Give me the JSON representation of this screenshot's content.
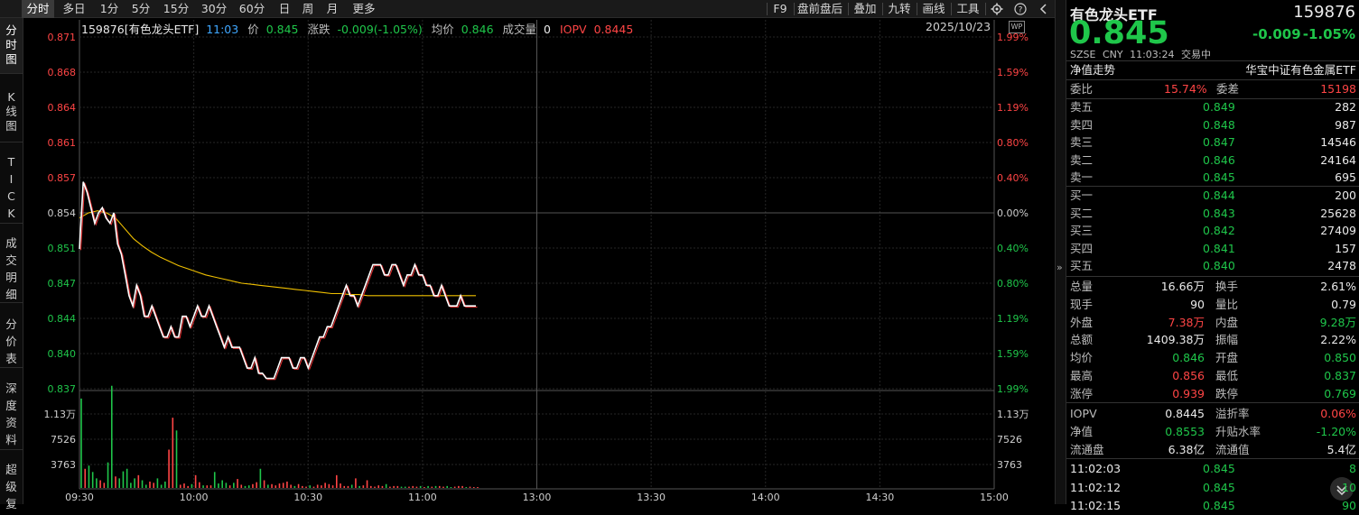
{
  "toolbar": {
    "tabs": [
      "分时",
      "多日",
      "1分",
      "5分",
      "15分",
      "30分",
      "60分",
      "日",
      "周",
      "月",
      "更多"
    ],
    "right_tools": [
      "F9",
      "盘前盘后",
      "叠加",
      "九转",
      "画线",
      "工具"
    ],
    "icons": [
      "settings-icon",
      "help-icon",
      "collapse-left-icon"
    ]
  },
  "sidetabs": [
    {
      "label": "分\n时\n图"
    },
    {
      "label": "K\n线\n图"
    },
    {
      "label": "T\nI\nC\nK"
    },
    {
      "label": "成\n交\n明\n细"
    },
    {
      "label": "分\n价\n表"
    },
    {
      "label": "深\n度\n资\n料"
    },
    {
      "label": "超\n级\n复"
    }
  ],
  "info": {
    "code_name": "159876[有色龙头ETF]",
    "time": "11:03",
    "price_label": "价",
    "price": "0.845",
    "change_label": "涨跌",
    "change": "-0.009(-1.05%)",
    "avg_label": "均价",
    "avg": "0.846",
    "volume_label": "成交量",
    "volume": "0",
    "iopv_label": "IOPV",
    "iopv": "0.8445",
    "date": "2025/10/23",
    "wp_badge": "WP"
  },
  "chart_data": {
    "type": "line",
    "price_ticks": [
      "0.871",
      "0.868",
      "0.864",
      "0.861",
      "0.857",
      "0.854",
      "0.851",
      "0.847",
      "0.844",
      "0.840",
      "0.837"
    ],
    "pct_ticks": [
      "1.99%",
      "1.59%",
      "1.19%",
      "0.80%",
      "0.40%",
      "0.00%",
      "0.40%",
      "0.80%",
      "1.19%",
      "1.59%",
      "1.99%"
    ],
    "ylim": [
      0.837,
      0.871
    ],
    "prev_close": 0.854,
    "x_ticks": [
      "09:30",
      "10:00",
      "10:30",
      "11:00",
      "13:00",
      "13:30",
      "14:00",
      "14:30",
      "15:00"
    ],
    "volume_ticks": [
      "1.13万",
      "7526",
      "3763"
    ],
    "volume_max": 15000,
    "price_series": [
      0.8505,
      0.857,
      0.856,
      0.8545,
      0.853,
      0.854,
      0.8545,
      0.8535,
      0.853,
      0.854,
      0.851,
      0.85,
      0.848,
      0.846,
      0.845,
      0.847,
      0.846,
      0.844,
      0.844,
      0.845,
      0.844,
      0.843,
      0.842,
      0.842,
      0.843,
      0.842,
      0.842,
      0.844,
      0.844,
      0.843,
      0.844,
      0.845,
      0.844,
      0.844,
      0.845,
      0.844,
      0.843,
      0.842,
      0.841,
      0.842,
      0.841,
      0.841,
      0.841,
      0.84,
      0.839,
      0.839,
      0.84,
      0.8385,
      0.8385,
      0.838,
      0.838,
      0.838,
      0.839,
      0.84,
      0.84,
      0.84,
      0.839,
      0.839,
      0.84,
      0.84,
      0.839,
      0.84,
      0.841,
      0.842,
      0.842,
      0.843,
      0.843,
      0.844,
      0.845,
      0.846,
      0.847,
      0.846,
      0.846,
      0.845,
      0.846,
      0.847,
      0.848,
      0.849,
      0.849,
      0.849,
      0.848,
      0.848,
      0.849,
      0.849,
      0.848,
      0.847,
      0.848,
      0.848,
      0.849,
      0.848,
      0.848,
      0.847,
      0.847,
      0.846,
      0.846,
      0.847,
      0.846,
      0.845,
      0.845,
      0.845,
      0.846,
      0.845,
      0.845,
      0.845,
      0.845
    ],
    "avg_series": [
      0.8535,
      0.854,
      0.8542,
      0.854,
      0.8535,
      0.8525,
      0.8515,
      0.8508,
      0.8502,
      0.8497,
      0.8493,
      0.8489,
      0.8486,
      0.8483,
      0.848,
      0.8478,
      0.8476,
      0.8474,
      0.8472,
      0.8471,
      0.847,
      0.8469,
      0.8468,
      0.8467,
      0.8466,
      0.8465,
      0.8464,
      0.8463,
      0.8462,
      0.8462,
      0.8461,
      0.8461,
      0.846,
      0.846,
      0.846,
      0.846,
      0.846,
      0.846,
      0.846,
      0.846,
      0.846,
      0.846,
      0.846,
      0.846,
      0.846
    ],
    "volume_series": [
      14000,
      3000,
      3500,
      2500,
      1500,
      1200,
      800,
      4000,
      16000,
      1800,
      1500,
      2600,
      3000,
      800,
      1500,
      2000,
      1200,
      500,
      1000,
      800,
      1500,
      500,
      1000,
      6000,
      11000,
      9000,
      500,
      700,
      300,
      600,
      2000,
      900,
      400,
      400,
      400,
      2500,
      700,
      1200,
      800,
      400,
      800,
      1400,
      500,
      300,
      400,
      600,
      900,
      3000,
      1200,
      500,
      600,
      400,
      700,
      800,
      1000,
      500,
      300,
      600,
      300,
      200,
      400,
      200,
      500,
      400,
      800,
      600,
      400,
      2000,
      700,
      300,
      300,
      500,
      1500,
      300,
      400,
      1200,
      300,
      200,
      400,
      300,
      600,
      200,
      300,
      300,
      200,
      200,
      200,
      300,
      200,
      300,
      100,
      300,
      200,
      300,
      300,
      200,
      300,
      100,
      200,
      300,
      300,
      100,
      200,
      100,
      100
    ]
  },
  "panel": {
    "name": "有色龙头ETF",
    "code": "159876",
    "price": "0.845",
    "change": "-0.009",
    "change_pct": "-1.05%",
    "exchange": "SZSE",
    "currency": "CNY",
    "time": "11:03:24",
    "status": "交易中",
    "nav_trend": "净值走势",
    "index_name": "华宝中证有色金属ETF",
    "weibi_label": "委比",
    "weibi": "15.74%",
    "weicha_label": "委差",
    "weicha": "15198",
    "asks": [
      {
        "label": "卖五",
        "price": "0.849",
        "vol": "282"
      },
      {
        "label": "卖四",
        "price": "0.848",
        "vol": "987"
      },
      {
        "label": "卖三",
        "price": "0.847",
        "vol": "14546"
      },
      {
        "label": "卖二",
        "price": "0.846",
        "vol": "24164"
      },
      {
        "label": "卖一",
        "price": "0.845",
        "vol": "695"
      }
    ],
    "bids": [
      {
        "label": "买一",
        "price": "0.844",
        "vol": "200"
      },
      {
        "label": "买二",
        "price": "0.843",
        "vol": "25628"
      },
      {
        "label": "买三",
        "price": "0.842",
        "vol": "27409"
      },
      {
        "label": "买四",
        "price": "0.841",
        "vol": "157"
      },
      {
        "label": "买五",
        "price": "0.840",
        "vol": "2478"
      }
    ],
    "stats": [
      {
        "l1": "总量",
        "v1": "16.66万",
        "c1": "white",
        "l2": "换手",
        "v2": "2.61%",
        "c2": "white"
      },
      {
        "l1": "现手",
        "v1": "90",
        "c1": "white",
        "l2": "量比",
        "v2": "0.79",
        "c2": "white"
      },
      {
        "l1": "外盘",
        "v1": "7.38万",
        "c1": "red",
        "l2": "内盘",
        "v2": "9.28万",
        "c2": "green"
      },
      {
        "l1": "总额",
        "v1": "1409.38万",
        "c1": "white",
        "l2": "振幅",
        "v2": "2.22%",
        "c2": "white"
      },
      {
        "l1": "均价",
        "v1": "0.846",
        "c1": "green",
        "l2": "开盘",
        "v2": "0.850",
        "c2": "green"
      },
      {
        "l1": "最高",
        "v1": "0.856",
        "c1": "red",
        "l2": "最低",
        "v2": "0.837",
        "c2": "green"
      },
      {
        "l1": "涨停",
        "v1": "0.939",
        "c1": "red",
        "l2": "跌停",
        "v2": "0.769",
        "c2": "green"
      }
    ],
    "etf_stats": [
      {
        "l1": "IOPV",
        "v1": "0.8445",
        "c1": "white",
        "l2": "溢折率",
        "v2": "0.06%",
        "c2": "red"
      },
      {
        "l1": "净值",
        "v1": "0.8553",
        "c1": "green",
        "l2": "升贴水率",
        "v2": "-1.20%",
        "c2": "green"
      },
      {
        "l1": "流通盘",
        "v1": "6.38亿",
        "c1": "white",
        "l2": "流通值",
        "v2": "5.4亿",
        "c2": "white"
      }
    ],
    "ticks": [
      {
        "time": "11:02:03",
        "price": "0.845",
        "vol": "8"
      },
      {
        "time": "11:02:12",
        "price": "0.845",
        "vol": "10"
      },
      {
        "time": "11:02:15",
        "price": "0.845",
        "vol": "90"
      }
    ]
  },
  "colors": {
    "up": "#ff4545",
    "down": "#1fc64a",
    "price_line": "#ffffff",
    "avg_line": "#f0c000",
    "kline_red": "#e03030"
  }
}
